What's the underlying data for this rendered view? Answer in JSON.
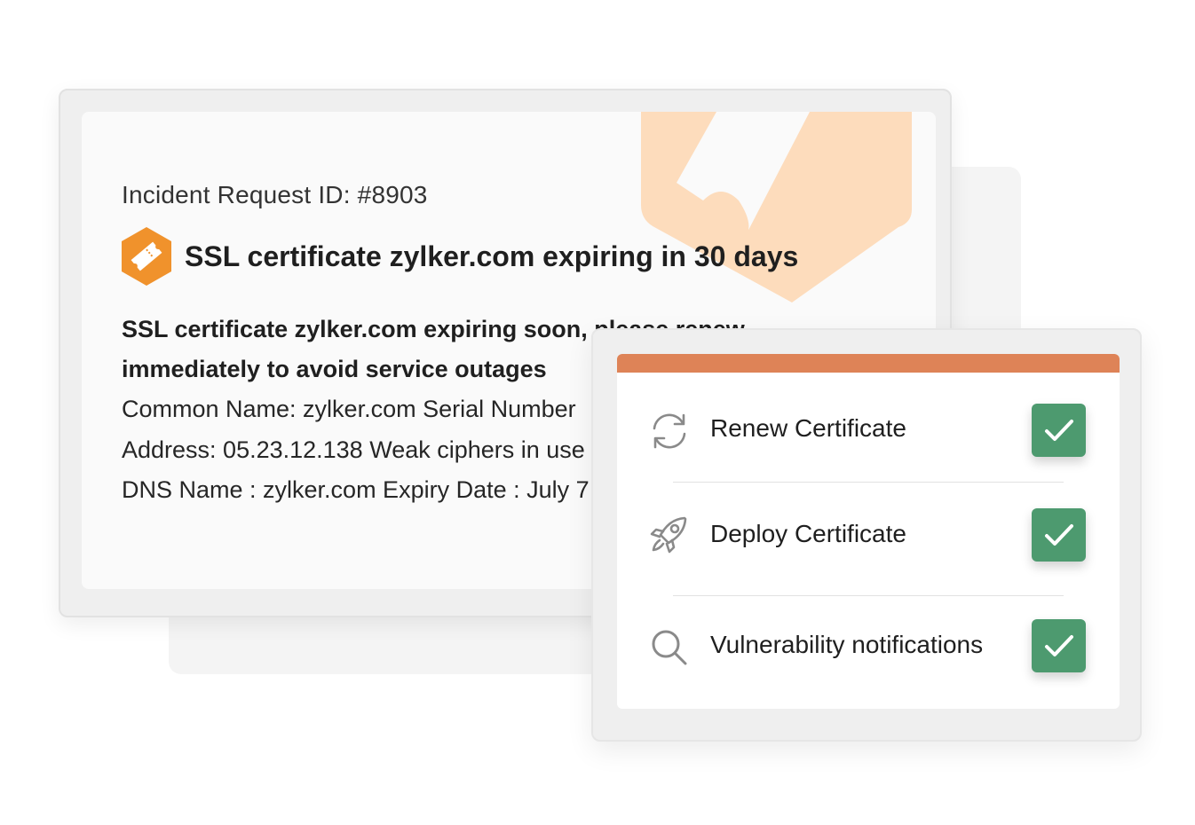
{
  "incident": {
    "request_id_label": "Incident Request ID: #8903",
    "title": "SSL certificate zylker.com expiring in 30 days",
    "badge_icon": "ticket-badge-icon",
    "summary": "SSL certificate zylker.com expiring soon, please renew immediately to avoid service outages",
    "details": [
      "Common Name: zylker.com Serial Number",
      "Address: 05.23.12.138 Weak ciphers in use",
      "DNS Name : zylker.com Expiry Date : July 7"
    ]
  },
  "actions": {
    "items": [
      {
        "label": "Renew Certificate",
        "icon": "refresh-icon",
        "checked": true
      },
      {
        "label": "Deploy Certificate",
        "icon": "rocket-icon",
        "checked": true
      },
      {
        "label": "Vulnerability notifications",
        "icon": "search-icon",
        "checked": true
      }
    ]
  },
  "colors": {
    "badge_orange": "#f0922c",
    "watermark_peach": "#fddcbc",
    "panel_accent": "#de8357",
    "check_green": "#4d9a6f"
  }
}
